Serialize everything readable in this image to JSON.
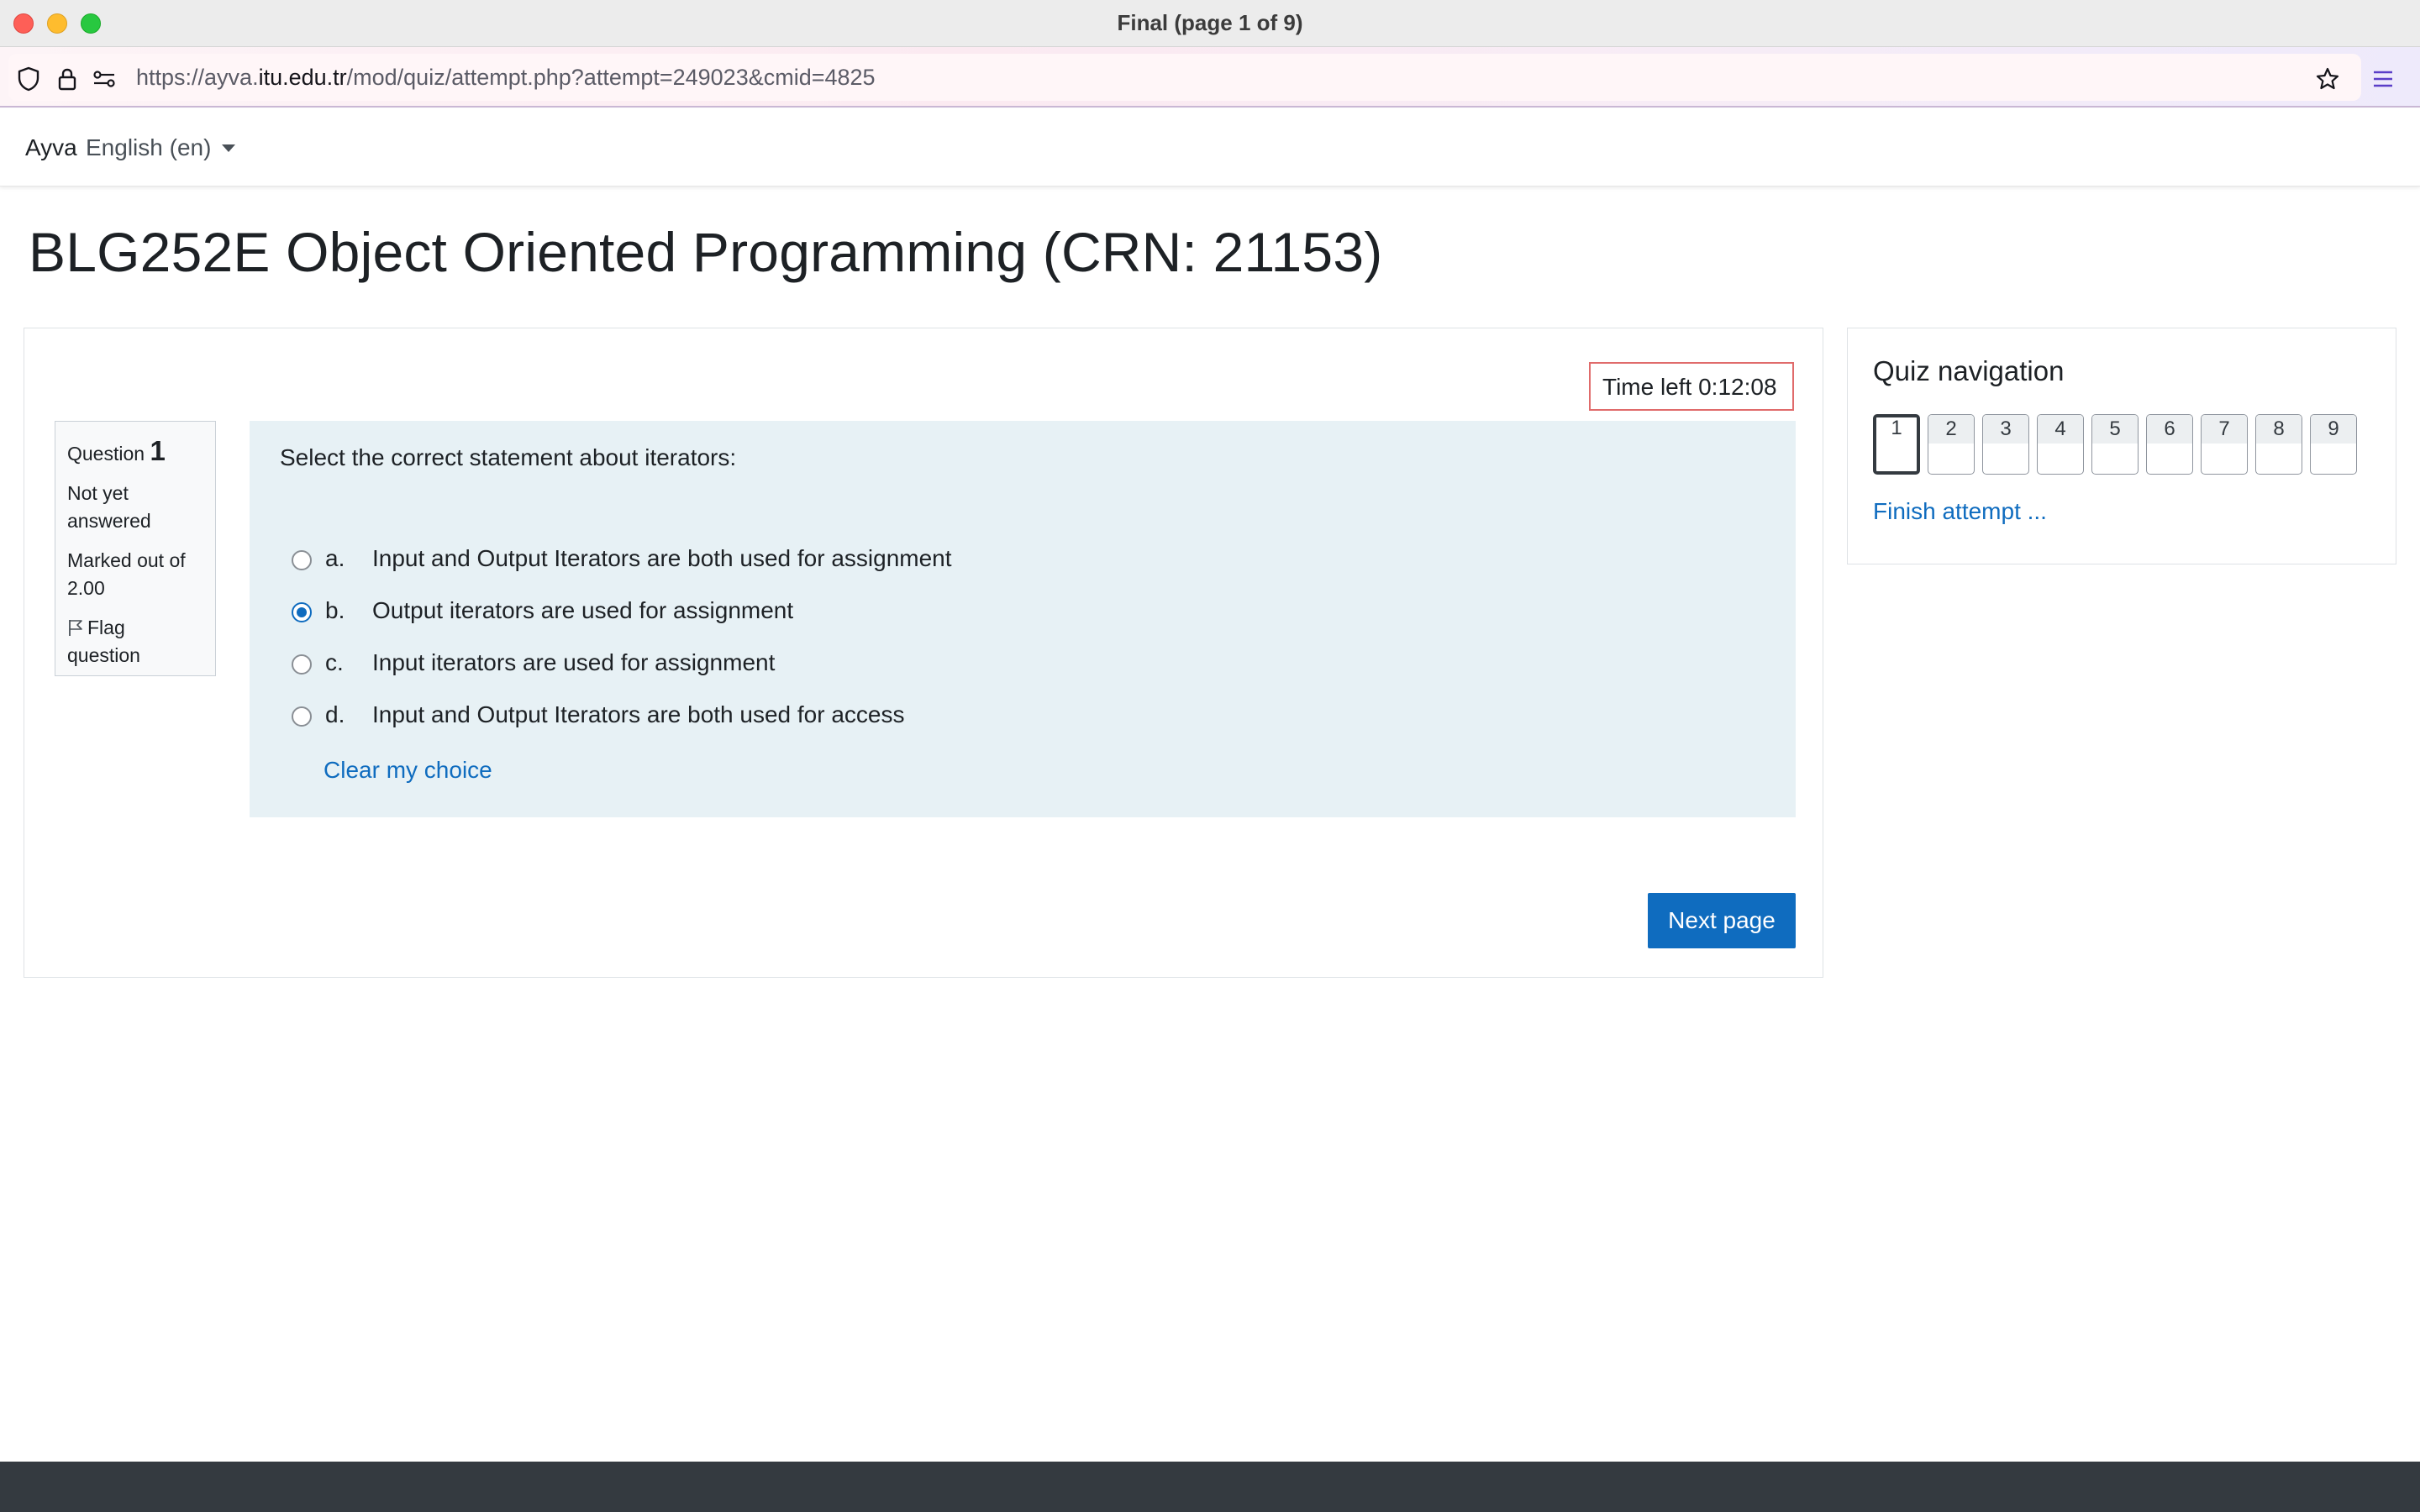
{
  "window": {
    "title": "Final (page 1 of 9)"
  },
  "browser": {
    "url_prefix": "https://ayva.",
    "url_host": "itu.edu.tr",
    "url_path": "/mod/quiz/attempt.php?attempt=249023&cmid=4825"
  },
  "navbar": {
    "brand": "Ayva",
    "language": "English (en)"
  },
  "page": {
    "title": "BLG252E Object Oriented Programming (CRN: 21153)"
  },
  "timer": {
    "text": "Time left 0:12:08"
  },
  "question": {
    "label": "Question",
    "number": "1",
    "state_line1": "Not yet",
    "state_line2": "answered",
    "marks_line1": "Marked out of",
    "marks_line2": "2.00",
    "flag_line1": "Flag",
    "flag_line2": "question",
    "text": "Select the correct statement about iterators:",
    "answers": [
      {
        "letter": "a.",
        "text": "Input and Output Iterators are both used for assignment",
        "checked": false
      },
      {
        "letter": "b.",
        "text": "Output iterators are used for assignment",
        "checked": true
      },
      {
        "letter": "c.",
        "text": "Input iterators are used for assignment",
        "checked": false
      },
      {
        "letter": "d.",
        "text": "Input and Output Iterators are both used for access",
        "checked": false
      }
    ],
    "clear_label": "Clear my choice"
  },
  "next_button": "Next page",
  "quiz_nav": {
    "title": "Quiz navigation",
    "buttons": [
      "1",
      "2",
      "3",
      "4",
      "5",
      "6",
      "7",
      "8",
      "9"
    ],
    "current": "1",
    "finish_label": "Finish attempt ..."
  },
  "colors": {
    "accent": "#0f6cbf",
    "question_bg": "#e7f1f5",
    "footer": "#343a40",
    "timer_border": "#e06b6b"
  }
}
